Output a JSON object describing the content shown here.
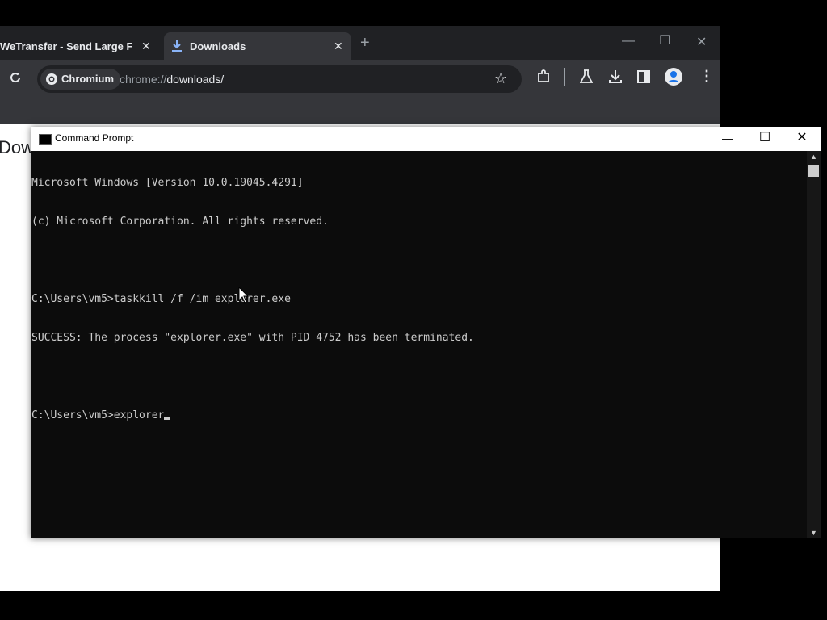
{
  "browser": {
    "tabs": [
      {
        "title": "WeTransfer - Send Large Files &",
        "active": false
      },
      {
        "title": "Downloads",
        "active": true
      }
    ],
    "new_tab_icon": "plus-icon",
    "omnibox": {
      "chip_label": "Chromium",
      "url_prefix": "chrome://",
      "url_host": "downloads/"
    },
    "page_heading": "Dow"
  },
  "cmd": {
    "title": "Command Prompt",
    "lines": [
      "Microsoft Windows [Version 10.0.19045.4291]",
      "(c) Microsoft Corporation. All rights reserved.",
      "",
      "C:\\Users\\vm5>taskkill /f /im explorer.exe",
      "SUCCESS: The process \"explorer.exe\" with PID 4752 has been terminated.",
      ""
    ],
    "prompt_line": "C:\\Users\\vm5>explorer"
  },
  "colors": {
    "console_bg": "#0c0c0c",
    "console_text": "#cccccc",
    "browser_dark": "#202124"
  }
}
